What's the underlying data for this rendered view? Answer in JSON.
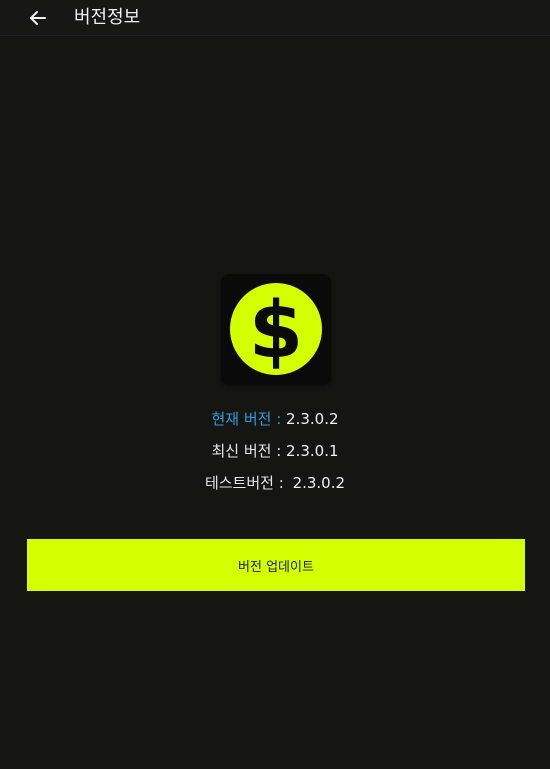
{
  "header": {
    "title": "버전정보",
    "back_icon": "arrow-left-icon"
  },
  "app_icon": {
    "icon": "dollar-coin-icon",
    "coin_color": "#d4ff00",
    "symbol": "$"
  },
  "versions": {
    "current_label": "현재 버전 :",
    "current_value": "2.3.0.2",
    "latest_label": "최신 버전 :",
    "latest_value": "2.3.0.1",
    "test_label": "테스트버전 :",
    "test_value": "2.3.0.2"
  },
  "update_button": {
    "label": "버전 업데이트",
    "color": "#d4ff00"
  }
}
